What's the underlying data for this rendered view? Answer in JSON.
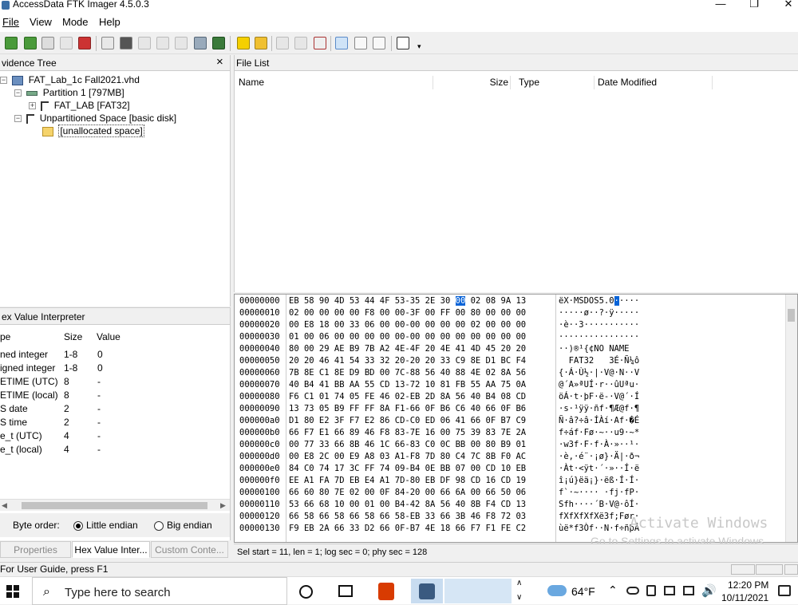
{
  "window": {
    "title": "AccessData FTK Imager 4.5.0.3",
    "minimize": "—",
    "maximize": "❐",
    "close": "✕"
  },
  "menu": [
    "File",
    "View",
    "Mode",
    "Help"
  ],
  "evidence_tree": {
    "title": "vidence Tree",
    "close": "×",
    "items": [
      {
        "label": "FAT_Lab_1c Fall2021.vhd",
        "expander": "−"
      },
      {
        "label": "Partition 1 [797MB]",
        "expander": "−"
      },
      {
        "label": "FAT_LAB [FAT32]",
        "expander": "+"
      },
      {
        "label": "Unpartitioned Space [basic disk]",
        "expander": "−"
      },
      {
        "label": "[unallocated space]",
        "expander": ""
      }
    ]
  },
  "file_list": {
    "title": "File List",
    "columns": [
      "Name",
      "Size",
      "Type",
      "Date Modified"
    ]
  },
  "hex_interpreter": {
    "title": "ex Value Interpreter",
    "columns": [
      "pe",
      "Size",
      "Value"
    ],
    "rows": [
      {
        "type": "ned integer",
        "size": "1-8",
        "value": "0"
      },
      {
        "type": "igned integer",
        "size": "1-8",
        "value": "0"
      },
      {
        "type": "ETIME (UTC)",
        "size": "8",
        "value": "-"
      },
      {
        "type": "ETIME (local)",
        "size": "8",
        "value": "-"
      },
      {
        "type": "S date",
        "size": "2",
        "value": "-"
      },
      {
        "type": "S time",
        "size": "2",
        "value": "-"
      },
      {
        "type": "e_t (UTC)",
        "size": "4",
        "value": "-"
      },
      {
        "type": "e_t (local)",
        "size": "4",
        "value": "-"
      }
    ],
    "byte_order_label": "Byte order:",
    "little_endian": "Little endian",
    "big_endian": "Big endian",
    "tabs": [
      "Properties",
      "Hex Value Inter...",
      "Custom Conte..."
    ]
  },
  "hex_view": {
    "rows": [
      {
        "off": "00000000",
        "bytes": "EB 58 90 4D 53 44 4F 53-35 2E 30 ",
        "sel": "00",
        "bytes2": " 02 08 9A 13",
        "ascii": "ëX·MSDOS5.0",
        "ascii_sel": "·",
        "ascii2": "····"
      },
      {
        "off": "00000010",
        "bytes": "02 00 00 00 00 F8 00 00-3F 00 FF 00 80 00 00 00",
        "ascii": "·····ø··?·ÿ·····"
      },
      {
        "off": "00000020",
        "bytes": "00 E8 18 00 33 06 00 00-00 00 00 00 02 00 00 00",
        "ascii": "·è··3···········"
      },
      {
        "off": "00000030",
        "bytes": "01 00 06 00 00 00 00 00-00 00 00 00 00 00 00 00",
        "ascii": "················"
      },
      {
        "off": "00000040",
        "bytes": "80 00 29 AE B9 7B A2 4E-4F 20 4E 41 4D 45 20 20",
        "ascii": "··)®¹{¢NO NAME  "
      },
      {
        "off": "00000050",
        "bytes": "20 20 46 41 54 33 32 20-20 20 33 C9 8E D1 BC F4",
        "ascii": "  FAT32   3É·Ñ¼ô"
      },
      {
        "off": "00000060",
        "bytes": "7B 8E C1 8E D9 BD 00 7C-88 56 40 88 4E 02 8A 56",
        "ascii": "{·Á·Ù½·|·V@·N··V"
      },
      {
        "off": "00000070",
        "bytes": "40 B4 41 BB AA 55 CD 13-72 10 81 FB 55 AA 75 0A",
        "ascii": "@´A»ªUÍ·r··ûUªu·"
      },
      {
        "off": "00000080",
        "bytes": "F6 C1 01 74 05 FE 46 02-EB 2D 8A 56 40 B4 08 CD",
        "ascii": "öÁ·t·þF·ë-·V@´·Í"
      },
      {
        "off": "00000090",
        "bytes": "13 73 05 B9 FF FF 8A F1-66 0F B6 C6 40 66 0F B6",
        "ascii": "·s·¹ÿÿ·ñf·¶Æ@f·¶"
      },
      {
        "off": "000000a0",
        "bytes": "D1 80 E2 3F F7 E2 86 CD-C0 ED 06 41 66 0F B7 C9",
        "ascii": "Ñ·â?÷â·ÍÀí·Af·�É"
      },
      {
        "off": "000000b0",
        "bytes": "66 F7 E1 66 89 46 F8 83-7E 16 00 75 39 83 7E 2A",
        "ascii": "f÷áf·Fø·~··u9·~*"
      },
      {
        "off": "000000c0",
        "bytes": "00 77 33 66 8B 46 1C 66-83 C0 0C BB 00 80 B9 01",
        "ascii": "·w3f·F·f·À·»··¹·"
      },
      {
        "off": "000000d0",
        "bytes": "00 E8 2C 00 E9 A8 03 A1-F8 7D 80 C4 7C 8B F0 AC",
        "ascii": "·è,·é¨·¡ø}·Ä|·ð¬"
      },
      {
        "off": "000000e0",
        "bytes": "84 C0 74 17 3C FF 74 09-B4 0E BB 07 00 CD 10 EB",
        "ascii": "·Àt·<ÿt·´·»··Í·ë"
      },
      {
        "off": "000000f0",
        "bytes": "EE A1 FA 7D EB E4 A1 7D-80 EB DF 98 CD 16 CD 19",
        "ascii": "î¡ú}ëä¡}·ëß·Í·Í·"
      },
      {
        "off": "00000100",
        "bytes": "66 60 80 7E 02 00 0F 84-20 00 66 6A 00 66 50 06",
        "ascii": "f`·~···· ·fj·fP·"
      },
      {
        "off": "00000110",
        "bytes": "53 66 68 10 00 01 00 B4-42 8A 56 40 8B F4 CD 13",
        "ascii": "Sfh····´B·V@·ôÍ·"
      },
      {
        "off": "00000120",
        "bytes": "66 58 66 58 66 58 66 58-EB 33 66 3B 46 F8 72 03",
        "ascii": "fXfXfXfXë3f;Før·"
      },
      {
        "off": "00000130",
        "bytes": "F9 EB 2A 66 33 D2 66 0F-B7 4E 18 66 F7 F1 FE C2",
        "ascii": "ùë*f3Òf··N·f÷ñþÂ"
      }
    ],
    "status": "Sel start = 11, len = 1; log sec = 0; phy sec = 128"
  },
  "watermark": {
    "line1": "Activate Windows",
    "line2": "Go to Settings to activate Windows."
  },
  "statusbar": "For User Guide, press F1",
  "taskbar": {
    "search_placeholder": "Type here to search",
    "temperature": "64°F",
    "time": "12:20 PM",
    "date": "10/11/2021"
  }
}
